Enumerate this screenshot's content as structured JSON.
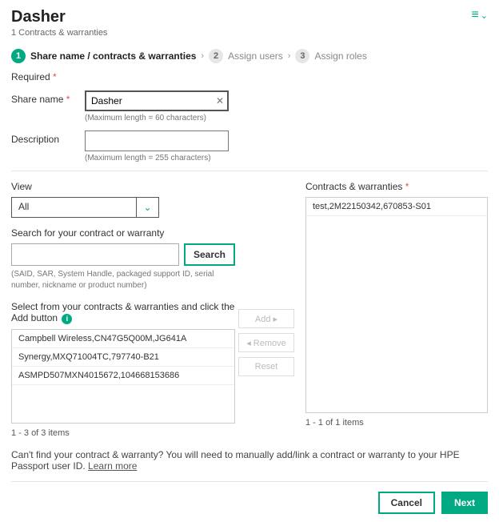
{
  "header": {
    "title": "Dasher",
    "subtitle": "1 Contracts & warranties"
  },
  "wizard": {
    "step1": {
      "num": "1",
      "label": "Share name / contracts & warranties"
    },
    "step2": {
      "num": "2",
      "label": "Assign users"
    },
    "step3": {
      "num": "3",
      "label": "Assign roles"
    }
  },
  "form": {
    "required_label": "Required",
    "share_name_label": "Share name",
    "share_name_value": "Dasher",
    "share_name_hint": "(Maximum length = 60 characters)",
    "description_label": "Description",
    "description_value": "",
    "description_hint": "(Maximum length = 255 characters)"
  },
  "left": {
    "view_label": "View",
    "view_value": "All",
    "search_label": "Search for your contract or warranty",
    "search_button": "Search",
    "search_hint": "(SAID, SAR, System Handle, packaged support ID, serial number, nickname or product number)",
    "select_label": "Select from your contracts & warranties and click the Add button",
    "items": [
      "Campbell Wireless,CN47G5Q00M,JG641A",
      "Synergy,MXQ71004TC,797740-B21",
      "ASMPD507MXN4015672,104668153686"
    ],
    "count": "1 - 3 of 3 items"
  },
  "mid": {
    "add": "Add ▸",
    "remove": "◂ Remove",
    "reset": "Reset"
  },
  "right": {
    "title": "Contracts & warranties",
    "items": [
      "test,2M22150342,670853-S01"
    ],
    "count": "1 - 1 of 1 items"
  },
  "help": {
    "text": "Can't find your contract & warranty? You will need to manually add/link a contract or warranty to your HPE Passport user ID. ",
    "link": "Learn more"
  },
  "footer": {
    "cancel": "Cancel",
    "next": "Next"
  }
}
